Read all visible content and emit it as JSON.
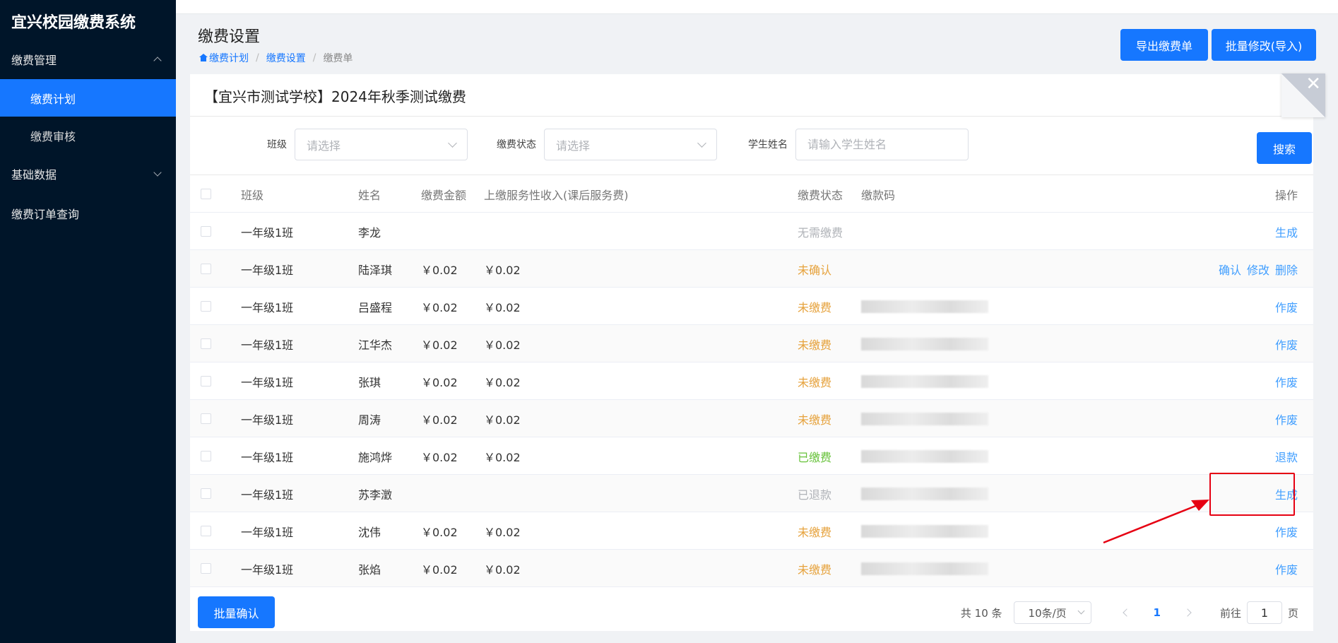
{
  "app": {
    "title": "宜兴校园缴费系统"
  },
  "sidebar": {
    "groups": [
      {
        "label": "缴费管理",
        "expanded": true,
        "items": [
          {
            "label": "缴费计划",
            "active": true
          },
          {
            "label": "缴费审核",
            "active": false
          }
        ]
      },
      {
        "label": "基础数据",
        "expanded": false,
        "items": []
      },
      {
        "label": "缴费订单查询",
        "items": []
      }
    ]
  },
  "header": {
    "title": "缴费设置",
    "breadcrumb": [
      "缴费计划",
      "缴费设置",
      "缴费单"
    ],
    "export_label": "导出缴费单",
    "batch_edit_label": "批量修改(导入)"
  },
  "card": {
    "title": "【宜兴市测试学校】2024年秋季测试缴费"
  },
  "filters": {
    "class_label": "班级",
    "class_placeholder": "请选择",
    "status_label": "缴费状态",
    "status_placeholder": "请选择",
    "name_label": "学生姓名",
    "name_placeholder": "请输入学生姓名",
    "search_label": "搜索"
  },
  "table": {
    "columns": [
      "班级",
      "姓名",
      "缴费金额",
      "上缴服务性收入(课后服务费)",
      "缴费状态",
      "缴款码",
      "操作"
    ],
    "rows": [
      {
        "class": "一年级1班",
        "name": "李龙",
        "amount": "",
        "income": "",
        "status": "无需缴费",
        "status_type": "none",
        "code_masked": false,
        "ops": [
          "生成"
        ]
      },
      {
        "class": "一年级1班",
        "name": "陆泽琪",
        "amount": "￥0.02",
        "income": "￥0.02",
        "status": "未确认",
        "status_type": "unconfirm",
        "code_masked": false,
        "ops": [
          "确认",
          "修改",
          "删除"
        ]
      },
      {
        "class": "一年级1班",
        "name": "吕盛程",
        "amount": "￥0.02",
        "income": "￥0.02",
        "status": "未缴费",
        "status_type": "unpaid",
        "code_masked": true,
        "ops": [
          "作废"
        ]
      },
      {
        "class": "一年级1班",
        "name": "江华杰",
        "amount": "￥0.02",
        "income": "￥0.02",
        "status": "未缴费",
        "status_type": "unpaid",
        "code_masked": true,
        "ops": [
          "作废"
        ]
      },
      {
        "class": "一年级1班",
        "name": "张琪",
        "amount": "￥0.02",
        "income": "￥0.02",
        "status": "未缴费",
        "status_type": "unpaid",
        "code_masked": true,
        "ops": [
          "作废"
        ]
      },
      {
        "class": "一年级1班",
        "name": "周涛",
        "amount": "￥0.02",
        "income": "￥0.02",
        "status": "未缴费",
        "status_type": "unpaid",
        "code_masked": true,
        "ops": [
          "作废"
        ]
      },
      {
        "class": "一年级1班",
        "name": "施鸿烨",
        "amount": "￥0.02",
        "income": "￥0.02",
        "status": "已缴费",
        "status_type": "paid",
        "code_masked": true,
        "ops": [
          "退款"
        ]
      },
      {
        "class": "一年级1班",
        "name": "苏李澂",
        "amount": "",
        "income": "",
        "status": "已退款",
        "status_type": "refund",
        "code_masked": true,
        "ops": [
          "生成"
        ]
      },
      {
        "class": "一年级1班",
        "name": "沈伟",
        "amount": "￥0.02",
        "income": "￥0.02",
        "status": "未缴费",
        "status_type": "unpaid",
        "code_masked": true,
        "ops": [
          "作废"
        ]
      },
      {
        "class": "一年级1班",
        "name": "张焰",
        "amount": "￥0.02",
        "income": "￥0.02",
        "status": "未缴费",
        "status_type": "unpaid",
        "code_masked": true,
        "ops": [
          "作废"
        ]
      }
    ]
  },
  "footer": {
    "batch_confirm_label": "批量确认",
    "total_text": "共 10 条",
    "page_size": "10条/页",
    "current_page": "1",
    "goto_prefix": "前往",
    "goto_value": "1",
    "goto_suffix": "页"
  },
  "colors": {
    "accent": "#1677ff",
    "sidebar_bg": "#001529",
    "warning": "#e6a23c",
    "success": "#67c23a",
    "annotation": "#e60012"
  }
}
